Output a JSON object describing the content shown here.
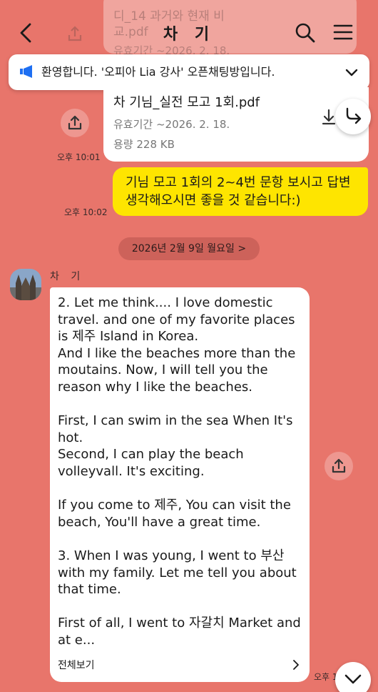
{
  "header": {
    "title": "차 기"
  },
  "background_file": {
    "name_line1": "디_14 과거와 현재 비",
    "name_line2": "교.pdf",
    "expiry": "유효기간 ~2026. 2. 18."
  },
  "notice": {
    "text": "환영합니다. '오피아 Lia 강사' 오픈채팅방입니다."
  },
  "file_message": {
    "name": "차 기님_실전 모고 1회.pdf",
    "expiry": "유효기간 ~2026. 2. 18.",
    "size": "용량 228 KB",
    "time": "오후 10:01"
  },
  "my_message": {
    "text": "기님 모고 1회의 2~4번 문항 보시고 답변\n생각해오시면 좋을 것 같습니다:)",
    "time": "오후 10:02"
  },
  "date_divider": {
    "label": "2026년 2월 9일 월요일 >"
  },
  "incoming_message": {
    "sender": "차 기",
    "text": "2. Let me think.... I love domestic travel. and one of my favorite places is 제주 Island in Korea.\nAnd I like the beaches more than the moutains. Now, I will tell you the reason why I like the beaches.\n\nFirst, I can swim in the sea When It's hot.\nSecond, I can play the beach volleyvall. It's exciting.\n\nIf you come to 제주, You can visit the beach, You'll have a great time.\n\n3. When I was young, I went to 부산 with my family. Let me tell you about that time.\n\nFirst of all, I went to 자갈치 Market and at e...",
    "see_all": "전체보기",
    "time": "오후 1"
  },
  "colors": {
    "background": "#e8756b",
    "my_bubble": "#fee500",
    "notice_accent": "#1e6ff2"
  }
}
